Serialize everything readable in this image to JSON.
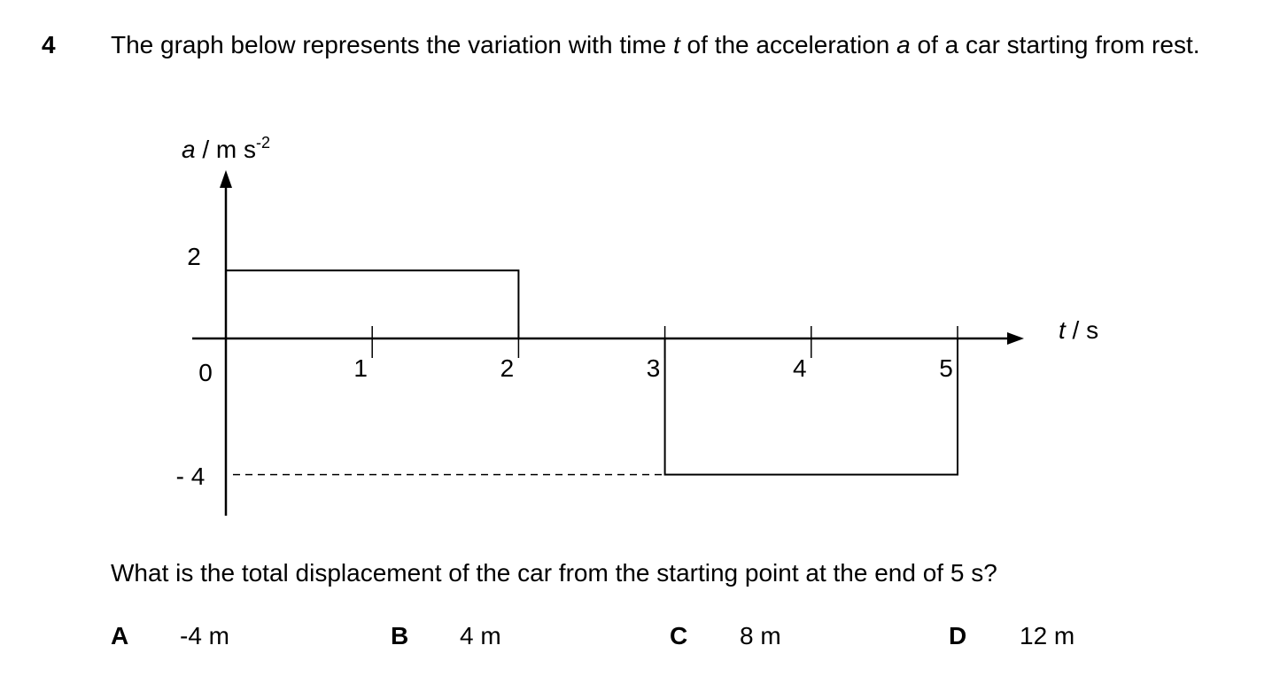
{
  "question": {
    "number": "4",
    "stem_before_t": "The graph below represents the variation with time ",
    "var_t": "t",
    "stem_mid": " of the acceleration ",
    "var_a": "a",
    "stem_after_a": " of a car starting from rest.",
    "ask": "What is the total displacement of the car from the starting point at the end of 5 s?"
  },
  "options": [
    {
      "letter": "A",
      "text": "-4 m"
    },
    {
      "letter": "B",
      "text": "4 m"
    },
    {
      "letter": "C",
      "text": "8 m"
    },
    {
      "letter": "D",
      "text": "12 m"
    }
  ],
  "chart_data": {
    "type": "line",
    "ylabel_var": "a",
    "ylabel_unit": " / m s",
    "ylabel_exp": "-2",
    "xlabel_var": "t",
    "xlabel_unit": " / s",
    "origin_label": "0",
    "x_ticks": [
      "1",
      "2",
      "3",
      "4",
      "5"
    ],
    "y_ticks": [
      "2",
      "- 4"
    ],
    "x_tick_values": [
      1,
      2,
      3,
      4,
      5
    ],
    "y_tick_values": [
      2,
      -4
    ],
    "segments": [
      {
        "t_start": 0,
        "t_end": 2,
        "a": 2
      },
      {
        "t_start": 2,
        "t_end": 3,
        "a": 0
      },
      {
        "t_start": 3,
        "t_end": 5,
        "a": -4
      }
    ],
    "xlim": [
      0,
      5
    ],
    "ylim": [
      -4,
      2
    ],
    "grid": false,
    "dashed_reference": {
      "a": -4,
      "from_t": 0,
      "to_t": 3
    }
  },
  "colors": {
    "ink": "#000000",
    "background": "#ffffff"
  }
}
